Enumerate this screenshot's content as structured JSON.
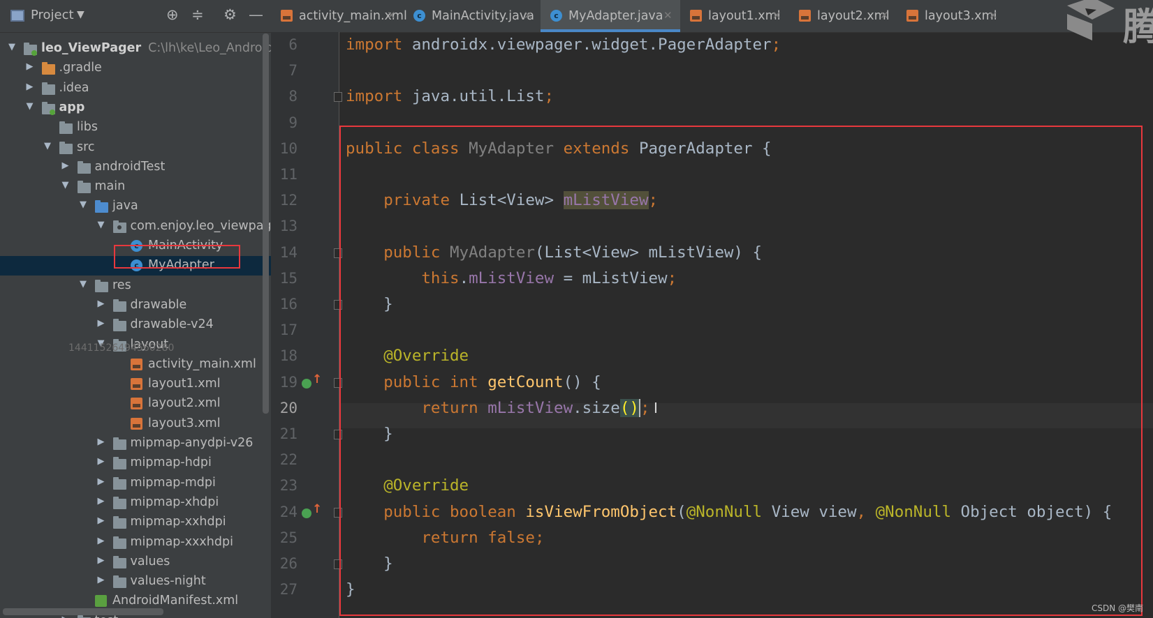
{
  "project_panel": {
    "title": "Project",
    "tree": [
      {
        "label": "leo_ViewPager",
        "path": "C:\\lh\\ke\\Leo_AndroidBa",
        "depth": 0,
        "expanded": true,
        "icon": "module-folder-icon"
      },
      {
        "label": ".gradle",
        "depth": 1,
        "expanded": false,
        "icon": "folder-orange-icon"
      },
      {
        "label": ".idea",
        "depth": 1,
        "expanded": false,
        "icon": "folder-icon"
      },
      {
        "label": "app",
        "depth": 1,
        "expanded": true,
        "icon": "module-folder-icon"
      },
      {
        "label": "libs",
        "depth": 2,
        "icon": "folder-icon"
      },
      {
        "label": "src",
        "depth": 2,
        "expanded": true,
        "icon": "folder-icon"
      },
      {
        "label": "androidTest",
        "depth": 3,
        "expanded": false,
        "icon": "folder-icon"
      },
      {
        "label": "main",
        "depth": 3,
        "expanded": true,
        "icon": "folder-icon"
      },
      {
        "label": "java",
        "depth": 4,
        "expanded": true,
        "icon": "folder-blue-icon"
      },
      {
        "label": "com.enjoy.leo_viewpager",
        "depth": 5,
        "expanded": true,
        "icon": "package-icon"
      },
      {
        "label": "MainActivity",
        "depth": 6,
        "icon": "java-class-icon"
      },
      {
        "label": "MyAdapter",
        "depth": 6,
        "icon": "java-class-icon",
        "selected": true
      },
      {
        "label": "res",
        "depth": 4,
        "expanded": true,
        "icon": "res-folder-icon"
      },
      {
        "label": "drawable",
        "depth": 5,
        "expanded": false,
        "icon": "folder-icon"
      },
      {
        "label": "drawable-v24",
        "depth": 5,
        "expanded": false,
        "icon": "folder-icon"
      },
      {
        "label": "layout",
        "depth": 5,
        "expanded": true,
        "icon": "folder-icon"
      },
      {
        "label": "activity_main.xml",
        "depth": 6,
        "icon": "xml-file-icon"
      },
      {
        "label": "layout1.xml",
        "depth": 6,
        "icon": "xml-file-icon"
      },
      {
        "label": "layout2.xml",
        "depth": 6,
        "icon": "xml-file-icon"
      },
      {
        "label": "layout3.xml",
        "depth": 6,
        "icon": "xml-file-icon"
      },
      {
        "label": "mipmap-anydpi-v26",
        "depth": 5,
        "expanded": false,
        "icon": "folder-icon"
      },
      {
        "label": "mipmap-hdpi",
        "depth": 5,
        "expanded": false,
        "icon": "folder-icon"
      },
      {
        "label": "mipmap-mdpi",
        "depth": 5,
        "expanded": false,
        "icon": "folder-icon"
      },
      {
        "label": "mipmap-xhdpi",
        "depth": 5,
        "expanded": false,
        "icon": "folder-icon"
      },
      {
        "label": "mipmap-xxhdpi",
        "depth": 5,
        "expanded": false,
        "icon": "folder-icon"
      },
      {
        "label": "mipmap-xxxhdpi",
        "depth": 5,
        "expanded": false,
        "icon": "folder-icon"
      },
      {
        "label": "values",
        "depth": 5,
        "expanded": false,
        "icon": "folder-icon"
      },
      {
        "label": "values-night",
        "depth": 5,
        "expanded": false,
        "icon": "folder-icon"
      },
      {
        "label": "AndroidManifest.xml",
        "depth": 4,
        "icon": "manifest-file-icon"
      },
      {
        "label": "test",
        "depth": 3,
        "expanded": false,
        "icon": "folder-icon"
      }
    ],
    "overlay_number": "14411526494560280"
  },
  "tabs": [
    {
      "label": "activity_main.xml",
      "icon": "xml-file-icon",
      "active": false
    },
    {
      "label": "MainActivity.java",
      "icon": "java-class-icon",
      "active": false
    },
    {
      "label": "MyAdapter.java",
      "icon": "java-class-icon",
      "active": true
    },
    {
      "label": "layout1.xml",
      "icon": "xml-file-icon",
      "active": false
    },
    {
      "label": "layout2.xml",
      "icon": "xml-file-icon",
      "active": false
    },
    {
      "label": "layout3.xml",
      "icon": "xml-file-icon",
      "active": false
    }
  ],
  "brand_char": "腾",
  "editor": {
    "current_line": 20,
    "lines": [
      {
        "no": "6",
        "tokens": [
          [
            "kw",
            "import"
          ],
          [
            "plain",
            " androidx.viewpager.widget.PagerAdapter"
          ],
          [
            "semi",
            ";"
          ]
        ]
      },
      {
        "no": "7",
        "tokens": []
      },
      {
        "no": "8",
        "tokens": [
          [
            "kw",
            "import"
          ],
          [
            "plain",
            " java.util.List"
          ],
          [
            "semi",
            ";"
          ]
        ]
      },
      {
        "no": "9",
        "tokens": []
      },
      {
        "no": "10",
        "tokens": [
          [
            "kw",
            "public class "
          ],
          [
            "cls-grey",
            "MyAdapter"
          ],
          [
            "kw",
            " extends "
          ],
          [
            "plain",
            "PagerAdapter {"
          ]
        ]
      },
      {
        "no": "11",
        "tokens": []
      },
      {
        "no": "12",
        "tokens": [
          [
            "plain",
            "    "
          ],
          [
            "kw",
            "private "
          ],
          [
            "plain",
            "List<View> "
          ],
          [
            "hl-field field",
            "mListView"
          ],
          [
            "semi",
            ";"
          ]
        ]
      },
      {
        "no": "13",
        "tokens": []
      },
      {
        "no": "14",
        "tokens": [
          [
            "plain",
            "    "
          ],
          [
            "kw",
            "public "
          ],
          [
            "cls-grey",
            "MyAdapter"
          ],
          [
            "plain",
            "(List<View> mListView) {"
          ]
        ]
      },
      {
        "no": "15",
        "tokens": [
          [
            "plain",
            "        "
          ],
          [
            "kw",
            "this"
          ],
          [
            "plain",
            "."
          ],
          [
            "field",
            "mListView"
          ],
          [
            "plain",
            " = mListView"
          ],
          [
            "semi",
            ";"
          ]
        ]
      },
      {
        "no": "16",
        "tokens": [
          [
            "plain",
            "    }"
          ]
        ]
      },
      {
        "no": "17",
        "tokens": []
      },
      {
        "no": "18",
        "tokens": [
          [
            "plain",
            "    "
          ],
          [
            "annot",
            "@Override"
          ]
        ]
      },
      {
        "no": "19",
        "tokens": [
          [
            "plain",
            "    "
          ],
          [
            "kw",
            "public int "
          ],
          [
            "method",
            "getCount"
          ],
          [
            "plain",
            "() {"
          ]
        ]
      },
      {
        "no": "20",
        "tokens": [
          [
            "plain",
            "        "
          ],
          [
            "kw",
            "return "
          ],
          [
            "field",
            "mListView"
          ],
          [
            "plain",
            ".size"
          ],
          [
            "paren-match",
            "()"
          ],
          [
            "caret",
            ""
          ],
          [
            "semi",
            ";"
          ]
        ]
      },
      {
        "no": "21",
        "tokens": [
          [
            "plain",
            "    }"
          ]
        ]
      },
      {
        "no": "22",
        "tokens": []
      },
      {
        "no": "23",
        "tokens": [
          [
            "plain",
            "    "
          ],
          [
            "annot",
            "@Override"
          ]
        ]
      },
      {
        "no": "24",
        "tokens": [
          [
            "plain",
            "    "
          ],
          [
            "kw",
            "public boolean "
          ],
          [
            "method",
            "isViewFromObject"
          ],
          [
            "plain",
            "("
          ],
          [
            "annot",
            "@NonNull"
          ],
          [
            "plain",
            " View view"
          ],
          [
            "kw",
            ", "
          ],
          [
            "annot",
            "@NonNull"
          ],
          [
            "plain",
            " Object object) {"
          ]
        ]
      },
      {
        "no": "25",
        "tokens": [
          [
            "plain",
            "        "
          ],
          [
            "kw",
            "return false"
          ],
          [
            "semi",
            ";"
          ]
        ]
      },
      {
        "no": "26",
        "tokens": [
          [
            "plain",
            "    }"
          ]
        ]
      },
      {
        "no": "27",
        "tokens": [
          [
            "plain",
            "}"
          ]
        ]
      }
    ]
  },
  "watermark": "CSDN @樊南",
  "colors": {
    "keyword": "#cc7832",
    "field": "#9876aa",
    "method": "#ffc66d",
    "annotation": "#bbb529",
    "highlight_box": "#e8383d",
    "selection": "#0d293e"
  }
}
